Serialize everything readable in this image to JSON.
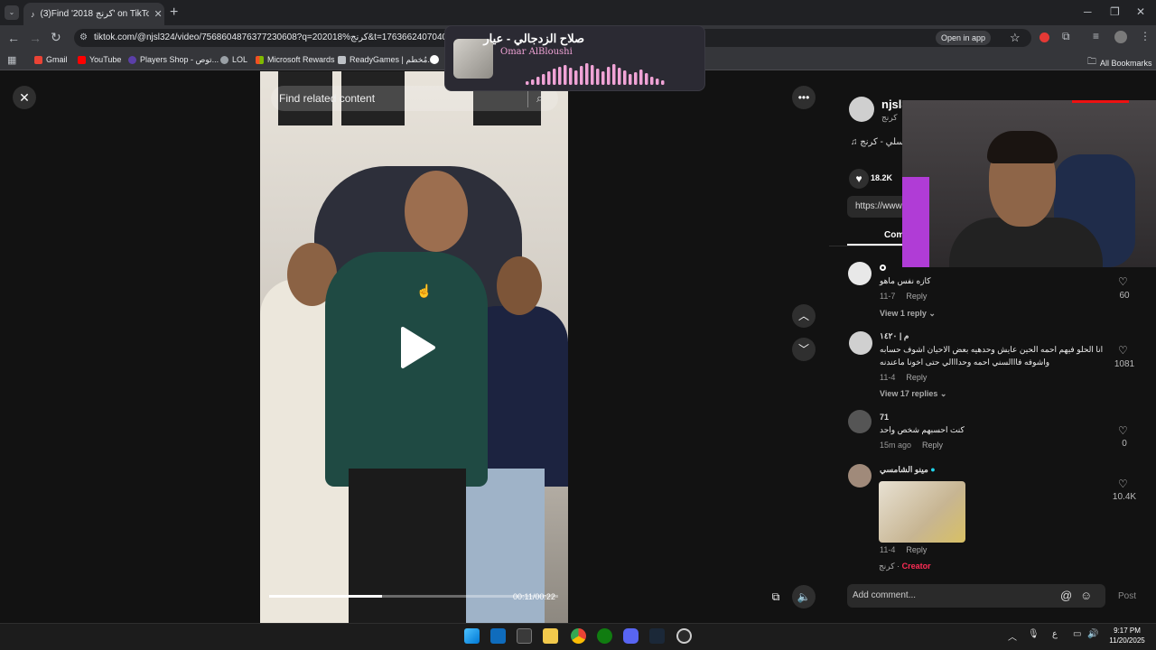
{
  "browser": {
    "tab_title": "(3)Find '2018 كرنج' on TikTok | T",
    "url": "tiktok.com/@njsl324/video/7568604876377230608?q=202018%كرنج&t=1763662407040",
    "open_in_app": "Open in app",
    "bookmarks": [
      "Gmail",
      "YouTube",
      "Players Shop - توص...",
      "LOL",
      "Microsoft Rewards",
      "ReadyGames | مُخطم..."
    ],
    "all_bookmarks": "All Bookmarks"
  },
  "media_popup": {
    "title": "صلاح الزدجالي - عيار",
    "artist": "Omar AlBloushi",
    "accent_color": "#f0a3d6"
  },
  "video": {
    "search_placeholder": "Find related content",
    "timecode": "00:11/00:22",
    "progress": 0.39
  },
  "panel": {
    "username": "njsl3",
    "nickname": "كرنج",
    "music": "سلي - كرنج",
    "likes": "18.2K",
    "link": "https://www",
    "comments_tab": "Com"
  },
  "comments": [
    {
      "name": "",
      "text": "كازه نفس ماهو",
      "date": "11-7",
      "reply": "Reply",
      "view_replies": "View 1 reply",
      "likes": "60"
    },
    {
      "name": "م | ١٤٢٠",
      "text": "انا الحلو فيهم احمه الحين عايش وحدهيه بعض الاحيان اشوف حسابه",
      "text2": "واشوفه فااالسني احمه وحدااالي حتى اخونا ماعندنه",
      "date": "11-4",
      "reply": "Reply",
      "view_replies": "View 17 replies",
      "likes": "1081"
    },
    {
      "name": "71",
      "text": "كنت احسبهم شخص واحد",
      "date": "15m ago",
      "reply": "Reply",
      "likes": "0"
    },
    {
      "name": "مينو الشامسي",
      "text": "",
      "date": "11-4",
      "reply": "Reply",
      "likes": "10.4K"
    }
  ],
  "creator_reply": {
    "name": "كرنج ·",
    "badge": "Creator"
  },
  "composer": {
    "placeholder": "Add comment...",
    "post": "Post"
  },
  "taskbar": {
    "time": "9:17 PM",
    "date": "11/20/2025",
    "lang": "ع"
  },
  "colors": {
    "accent": "#fe2c55",
    "bg": "#121212"
  }
}
